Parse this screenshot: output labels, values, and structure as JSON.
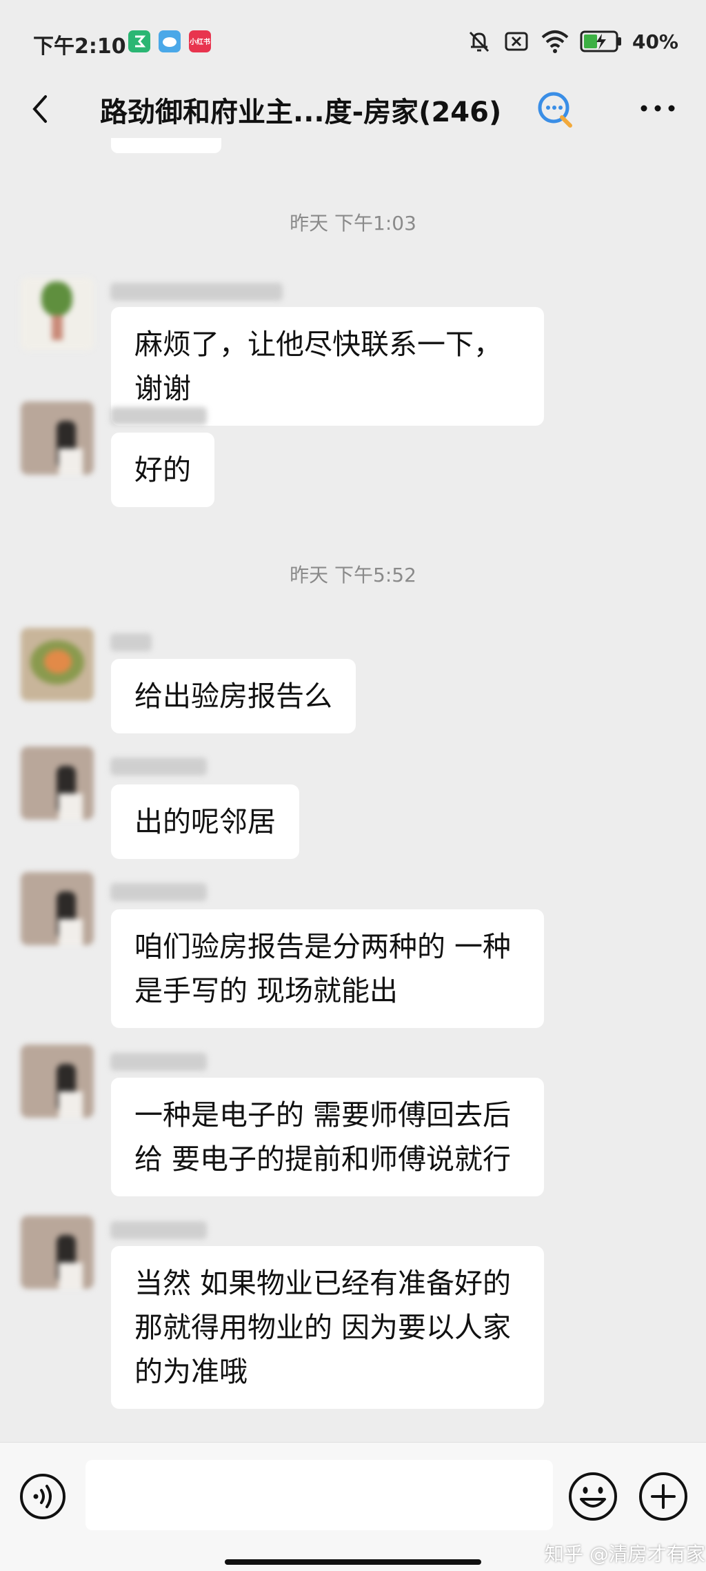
{
  "status_bar": {
    "time": "下午2:10",
    "app_badges": [
      {
        "label": "",
        "color": "#2bb673"
      },
      {
        "label": "",
        "color": "#4aa8e8"
      },
      {
        "label": "小红书",
        "color": "#e8344e"
      }
    ],
    "battery": "40%"
  },
  "header": {
    "title": "路劲御和府业主...度-房家(246)"
  },
  "messages": [
    {
      "type": "timestamp",
      "text": "昨天 下午1:03"
    },
    {
      "type": "message",
      "text": "麻烦了，让他尽快联系一下，谢谢"
    },
    {
      "type": "message",
      "text": "好的"
    },
    {
      "type": "timestamp",
      "text": "昨天 下午5:52"
    },
    {
      "type": "message",
      "text": "给出验房报告么"
    },
    {
      "type": "message",
      "text": "出的呢邻居"
    },
    {
      "type": "message",
      "text": "咱们验房报告是分两种的  一种是手写的 现场就能出"
    },
    {
      "type": "message",
      "text": "一种是电子的  需要师傅回去后给  要电子的提前和师傅说就行"
    },
    {
      "type": "message",
      "text": "当然  如果物业已经有准备好的  那就得用物业的  因为要以人家的为准哦"
    }
  ],
  "watermark": "知乎 @清房才有家",
  "colors": {
    "background": "#ededed",
    "bubble": "#ffffff",
    "timestamp": "#8a8a8a"
  }
}
